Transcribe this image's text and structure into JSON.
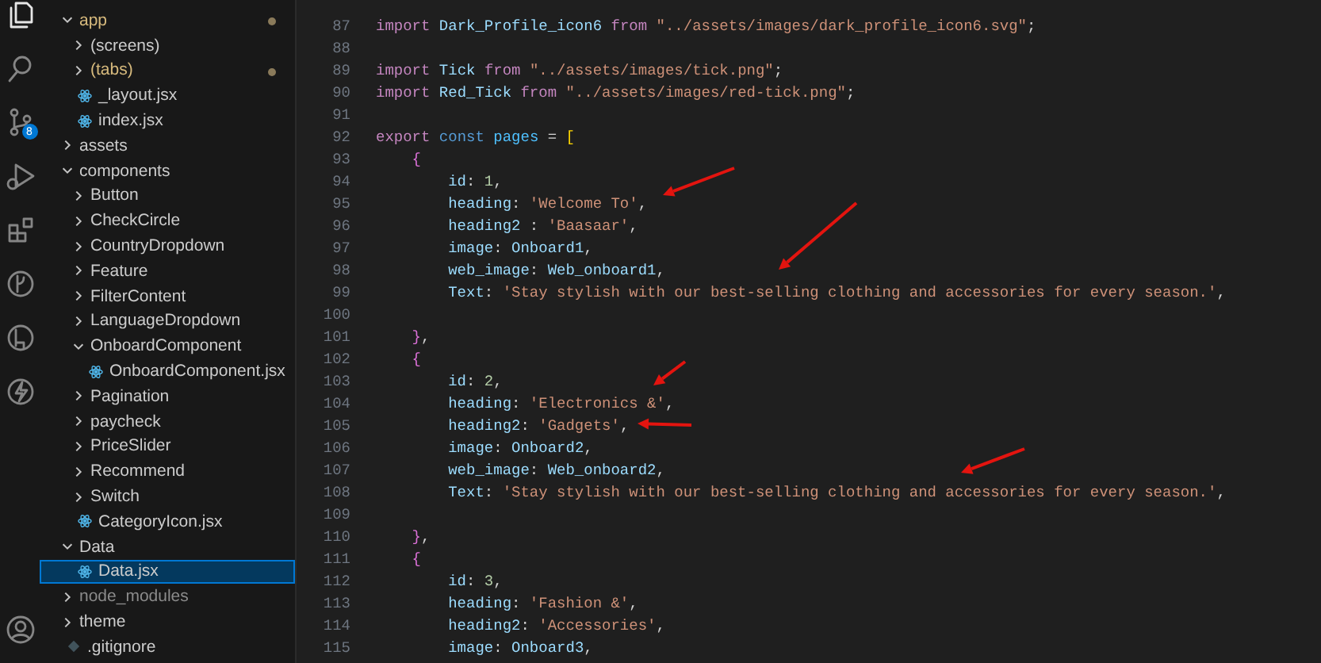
{
  "activity_bar": [
    {
      "kind": "files",
      "selected": true
    },
    {
      "kind": "search",
      "selected": false
    },
    {
      "kind": "source-control",
      "selected": false,
      "badge": "8"
    },
    {
      "kind": "run",
      "selected": false
    },
    {
      "kind": "extensions",
      "selected": false
    },
    {
      "kind": "branch-circle",
      "selected": false
    },
    {
      "kind": "tag-circle",
      "selected": false
    },
    {
      "kind": "lightning",
      "selected": false
    },
    {
      "kind": "account",
      "selected": false
    }
  ],
  "explorer": {
    "items": [
      {
        "kind": "folder",
        "label": "app",
        "expanded": true,
        "modified": true,
        "selected": false,
        "dimmed": false,
        "children": [
          {
            "kind": "folder",
            "label": "(screens)",
            "expanded": false,
            "modified": false,
            "selected": false,
            "dimmed": false
          },
          {
            "kind": "folder",
            "label": "(tabs)",
            "expanded": false,
            "modified": true,
            "selected": false,
            "dimmed": false
          },
          {
            "kind": "react-file",
            "label": "_layout.jsx",
            "modified": false,
            "selected": false,
            "dimmed": false
          },
          {
            "kind": "react-file",
            "label": "index.jsx",
            "modified": false,
            "selected": false,
            "dimmed": false
          }
        ]
      },
      {
        "kind": "folder",
        "label": "assets",
        "expanded": false,
        "modified": false,
        "selected": false,
        "dimmed": false
      },
      {
        "kind": "folder",
        "label": "components",
        "expanded": true,
        "modified": false,
        "selected": false,
        "dimmed": false,
        "children": [
          {
            "kind": "folder",
            "label": "Button",
            "expanded": false,
            "modified": false,
            "selected": false,
            "dimmed": false
          },
          {
            "kind": "folder",
            "label": "CheckCircle",
            "expanded": false,
            "modified": false,
            "selected": false,
            "dimmed": false
          },
          {
            "kind": "folder",
            "label": "CountryDropdown",
            "expanded": false,
            "modified": false,
            "selected": false,
            "dimmed": false
          },
          {
            "kind": "folder",
            "label": "Feature",
            "expanded": false,
            "modified": false,
            "selected": false,
            "dimmed": false
          },
          {
            "kind": "folder",
            "label": "FilterContent",
            "expanded": false,
            "modified": false,
            "selected": false,
            "dimmed": false
          },
          {
            "kind": "folder",
            "label": "LanguageDropdown",
            "expanded": false,
            "modified": false,
            "selected": false,
            "dimmed": false
          },
          {
            "kind": "folder",
            "label": "OnboardComponent",
            "expanded": true,
            "modified": false,
            "selected": false,
            "dimmed": false,
            "children": [
              {
                "kind": "react-file",
                "label": "OnboardComponent.jsx",
                "modified": false,
                "selected": false,
                "dimmed": false
              }
            ]
          },
          {
            "kind": "folder",
            "label": "Pagination",
            "expanded": false,
            "modified": false,
            "selected": false,
            "dimmed": false
          },
          {
            "kind": "folder",
            "label": "paycheck",
            "expanded": false,
            "modified": false,
            "selected": false,
            "dimmed": false
          },
          {
            "kind": "folder",
            "label": "PriceSlider",
            "expanded": false,
            "modified": false,
            "selected": false,
            "dimmed": false
          },
          {
            "kind": "folder",
            "label": "Recommend",
            "expanded": false,
            "modified": false,
            "selected": false,
            "dimmed": false
          },
          {
            "kind": "folder",
            "label": "Switch",
            "expanded": false,
            "modified": false,
            "selected": false,
            "dimmed": false
          },
          {
            "kind": "react-file",
            "label": "CategoryIcon.jsx",
            "modified": false,
            "selected": false,
            "dimmed": false
          }
        ]
      },
      {
        "kind": "folder",
        "label": "Data",
        "expanded": true,
        "modified": false,
        "selected": false,
        "dimmed": false,
        "children": [
          {
            "kind": "react-file",
            "label": "Data.jsx",
            "modified": false,
            "selected": true,
            "dimmed": false
          }
        ]
      },
      {
        "kind": "folder",
        "label": "node_modules",
        "expanded": false,
        "modified": false,
        "selected": false,
        "dimmed": true
      },
      {
        "kind": "folder",
        "label": "theme",
        "expanded": false,
        "modified": false,
        "selected": false,
        "dimmed": false
      },
      {
        "kind": "git-file",
        "label": ".gitignore",
        "modified": false,
        "selected": false,
        "dimmed": false
      }
    ]
  },
  "editor": {
    "lines": [
      {
        "number": "87",
        "tokens": [
          {
            "kind": "keyword",
            "text": "import "
          },
          {
            "kind": "ident",
            "text": "Dark_Profile_icon6 "
          },
          {
            "kind": "keyword",
            "text": "from "
          },
          {
            "kind": "string",
            "text": "\"../assets/images/dark_profile_icon6.svg\""
          },
          {
            "kind": "plain",
            "text": ";"
          }
        ]
      },
      {
        "number": "88"
      },
      {
        "number": "89",
        "tokens": [
          {
            "kind": "keyword",
            "text": "import "
          },
          {
            "kind": "ident",
            "text": "Tick "
          },
          {
            "kind": "keyword",
            "text": "from "
          },
          {
            "kind": "string",
            "text": "\"../assets/images/tick.png\""
          },
          {
            "kind": "plain",
            "text": ";"
          }
        ]
      },
      {
        "number": "90",
        "tokens": [
          {
            "kind": "keyword",
            "text": "import "
          },
          {
            "kind": "ident",
            "text": "Red_Tick "
          },
          {
            "kind": "keyword",
            "text": "from "
          },
          {
            "kind": "string",
            "text": "\"../assets/images/red-tick.png\""
          },
          {
            "kind": "plain",
            "text": ";"
          }
        ]
      },
      {
        "number": "91"
      },
      {
        "number": "92",
        "tokens": [
          {
            "kind": "keyword",
            "text": "export "
          },
          {
            "kind": "storage",
            "text": "const "
          },
          {
            "kind": "constant",
            "text": "pages "
          },
          {
            "kind": "plain",
            "text": "= "
          },
          {
            "kind": "bracket",
            "text": "["
          }
        ]
      },
      {
        "number": "93",
        "tokens": [
          {
            "kind": "brace",
            "text": "    {"
          }
        ]
      },
      {
        "number": "94",
        "tokens": [
          {
            "kind": "ident",
            "text": "        id"
          },
          {
            "kind": "plain",
            "text": ": "
          },
          {
            "kind": "number",
            "text": "1"
          },
          {
            "kind": "plain",
            "text": ","
          }
        ]
      },
      {
        "number": "95",
        "tokens": [
          {
            "kind": "ident",
            "text": "        heading"
          },
          {
            "kind": "plain",
            "text": ": "
          },
          {
            "kind": "string",
            "text": "'Welcome To'"
          },
          {
            "kind": "plain",
            "text": ","
          }
        ]
      },
      {
        "number": "96",
        "tokens": [
          {
            "kind": "ident",
            "text": "        heading2 "
          },
          {
            "kind": "plain",
            "text": ": "
          },
          {
            "kind": "string",
            "text": "'Baasaar'"
          },
          {
            "kind": "plain",
            "text": ","
          }
        ]
      },
      {
        "number": "97",
        "tokens": [
          {
            "kind": "ident",
            "text": "        image"
          },
          {
            "kind": "plain",
            "text": ": "
          },
          {
            "kind": "ident",
            "text": "Onboard1"
          },
          {
            "kind": "plain",
            "text": ","
          }
        ]
      },
      {
        "number": "98",
        "tokens": [
          {
            "kind": "ident",
            "text": "        web_image"
          },
          {
            "kind": "plain",
            "text": ": "
          },
          {
            "kind": "ident",
            "text": "Web_onboard1"
          },
          {
            "kind": "plain",
            "text": ","
          }
        ]
      },
      {
        "number": "99",
        "tokens": [
          {
            "kind": "ident",
            "text": "        Text"
          },
          {
            "kind": "plain",
            "text": ": "
          },
          {
            "kind": "string",
            "text": "'Stay stylish with our best-selling clothing and accessories for every season.'"
          },
          {
            "kind": "plain",
            "text": ","
          }
        ]
      },
      {
        "number": "100"
      },
      {
        "number": "101",
        "tokens": [
          {
            "kind": "brace",
            "text": "    }"
          },
          {
            "kind": "plain",
            "text": ","
          }
        ]
      },
      {
        "number": "102",
        "tokens": [
          {
            "kind": "brace",
            "text": "    {"
          }
        ]
      },
      {
        "number": "103",
        "tokens": [
          {
            "kind": "ident",
            "text": "        id"
          },
          {
            "kind": "plain",
            "text": ": "
          },
          {
            "kind": "number",
            "text": "2"
          },
          {
            "kind": "plain",
            "text": ","
          }
        ]
      },
      {
        "number": "104",
        "tokens": [
          {
            "kind": "ident",
            "text": "        heading"
          },
          {
            "kind": "plain",
            "text": ": "
          },
          {
            "kind": "string",
            "text": "'Electronics &'"
          },
          {
            "kind": "plain",
            "text": ","
          }
        ]
      },
      {
        "number": "105",
        "tokens": [
          {
            "kind": "ident",
            "text": "        heading2"
          },
          {
            "kind": "plain",
            "text": ": "
          },
          {
            "kind": "string",
            "text": "'Gadgets'"
          },
          {
            "kind": "plain",
            "text": ","
          }
        ]
      },
      {
        "number": "106",
        "tokens": [
          {
            "kind": "ident",
            "text": "        image"
          },
          {
            "kind": "plain",
            "text": ": "
          },
          {
            "kind": "ident",
            "text": "Onboard2"
          },
          {
            "kind": "plain",
            "text": ","
          }
        ]
      },
      {
        "number": "107",
        "tokens": [
          {
            "kind": "ident",
            "text": "        web_image"
          },
          {
            "kind": "plain",
            "text": ": "
          },
          {
            "kind": "ident",
            "text": "Web_onboard2"
          },
          {
            "kind": "plain",
            "text": ","
          }
        ]
      },
      {
        "number": "108",
        "tokens": [
          {
            "kind": "ident",
            "text": "        Text"
          },
          {
            "kind": "plain",
            "text": ": "
          },
          {
            "kind": "string",
            "text": "'Stay stylish with our best-selling clothing and accessories for every season.'"
          },
          {
            "kind": "plain",
            "text": ","
          }
        ]
      },
      {
        "number": "109"
      },
      {
        "number": "110",
        "tokens": [
          {
            "kind": "brace",
            "text": "    }"
          },
          {
            "kind": "plain",
            "text": ","
          }
        ]
      },
      {
        "number": "111",
        "tokens": [
          {
            "kind": "brace",
            "text": "    {"
          }
        ]
      },
      {
        "number": "112",
        "tokens": [
          {
            "kind": "ident",
            "text": "        id"
          },
          {
            "kind": "plain",
            "text": ": "
          },
          {
            "kind": "number",
            "text": "3"
          },
          {
            "kind": "plain",
            "text": ","
          }
        ]
      },
      {
        "number": "113",
        "tokens": [
          {
            "kind": "ident",
            "text": "        heading"
          },
          {
            "kind": "plain",
            "text": ": "
          },
          {
            "kind": "string",
            "text": "'Fashion &'"
          },
          {
            "kind": "plain",
            "text": ","
          }
        ]
      },
      {
        "number": "114",
        "tokens": [
          {
            "kind": "ident",
            "text": "        heading2"
          },
          {
            "kind": "plain",
            "text": ": "
          },
          {
            "kind": "string",
            "text": "'Accessories'"
          },
          {
            "kind": "plain",
            "text": ","
          }
        ]
      },
      {
        "number": "115",
        "tokens": [
          {
            "kind": "ident",
            "text": "        image"
          },
          {
            "kind": "plain",
            "text": ": "
          },
          {
            "kind": "ident",
            "text": "Onboard3"
          },
          {
            "kind": "plain",
            "text": ","
          }
        ]
      }
    ]
  },
  "annotations": [
    {
      "kind": "arrow"
    },
    {
      "kind": "arrow"
    },
    {
      "kind": "arrow"
    },
    {
      "kind": "arrow"
    },
    {
      "kind": "arrow"
    }
  ]
}
